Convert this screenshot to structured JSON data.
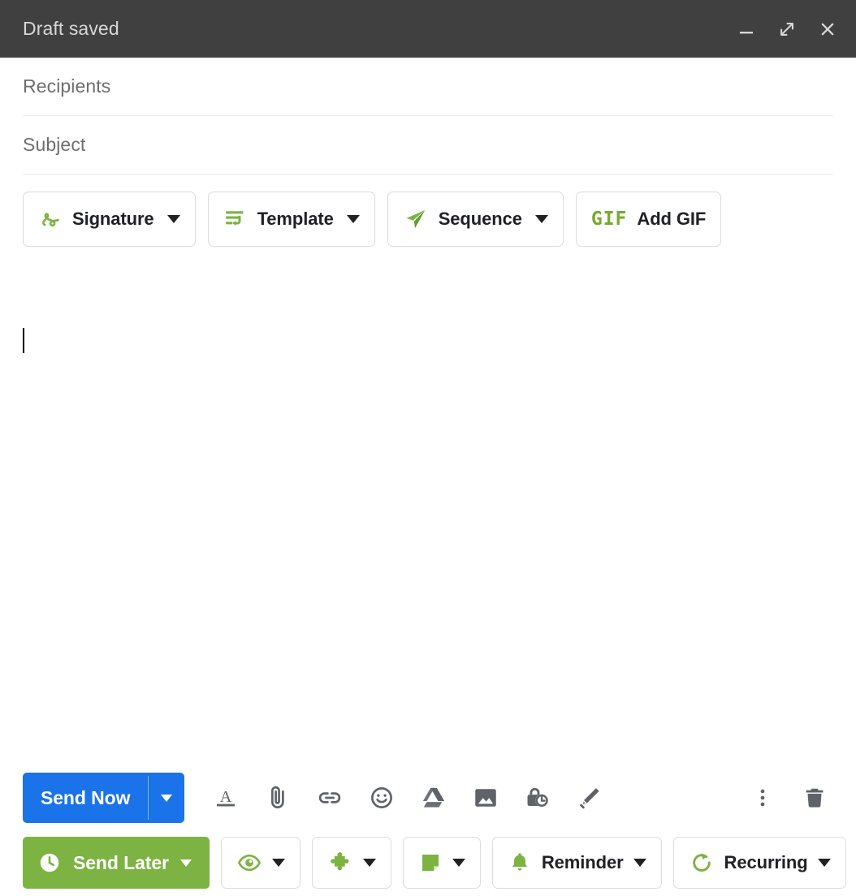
{
  "window": {
    "title": "Draft saved",
    "controls": [
      {
        "name": "minimize-button",
        "icon": "minimize-icon"
      },
      {
        "name": "expand-button",
        "icon": "expand-diagonal-icon"
      },
      {
        "name": "close-button",
        "icon": "close-icon"
      }
    ]
  },
  "fields": {
    "recipients_placeholder": "Recipients",
    "subject_placeholder": "Subject",
    "recipients_value": "",
    "subject_value": "",
    "body_value": ""
  },
  "top_toolbar": {
    "buttons": [
      {
        "label": "Signature",
        "icon": "signature-squiggle-icon",
        "has_caret": true
      },
      {
        "label": "Template",
        "icon": "template-lines-icon",
        "has_caret": true
      },
      {
        "label": "Sequence",
        "icon": "paper-plane-icon",
        "has_caret": true
      },
      {
        "label": "Add GIF",
        "icon": "gif-icon",
        "has_caret": false,
        "glyph": "GIF"
      }
    ]
  },
  "send_row": {
    "send_now_label": "Send Now",
    "icons": [
      {
        "name": "format-text-icon",
        "title": "Formatting options"
      },
      {
        "name": "attachment-paperclip-icon",
        "title": "Attach files"
      },
      {
        "name": "insert-link-icon",
        "title": "Insert link"
      },
      {
        "name": "emoji-icon",
        "title": "Insert emoji"
      },
      {
        "name": "google-drive-icon",
        "title": "Insert files using Drive"
      },
      {
        "name": "insert-photo-icon",
        "title": "Insert photo"
      },
      {
        "name": "confidential-mode-icon",
        "title": "Toggle confidential mode"
      },
      {
        "name": "pen-signature-icon",
        "title": "Insert signature"
      }
    ],
    "right_icons": [
      {
        "name": "more-options-icon",
        "title": "More options"
      },
      {
        "name": "discard-draft-icon",
        "title": "Discard draft"
      }
    ]
  },
  "plugin_row": {
    "send_later_label": "Send Later",
    "buttons": [
      {
        "label": "",
        "icon": "eye-tracking-icon",
        "has_caret": true
      },
      {
        "label": "",
        "icon": "puzzle-piece-icon",
        "has_caret": true
      },
      {
        "label": "",
        "icon": "sticky-note-icon",
        "has_caret": true
      },
      {
        "label": "Reminder",
        "icon": "bell-icon",
        "has_caret": true
      },
      {
        "label": "Recurring",
        "icon": "refresh-circular-icon",
        "has_caret": true
      }
    ]
  },
  "colors": {
    "titlebar_bg": "#404040",
    "send_now_blue": "#1a73e8",
    "send_later_green": "#7cb342",
    "accent_green": "#7cb342",
    "icon_gray": "#5f6368",
    "divider": "#e8eaed"
  }
}
